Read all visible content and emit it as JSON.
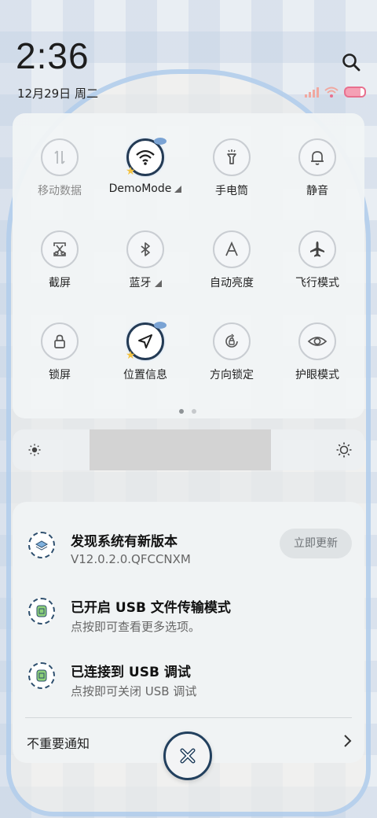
{
  "status_bar": {
    "time": "2:36",
    "date": "12月29日 周二"
  },
  "tiles": [
    {
      "label": "移动数据",
      "icon": "mobile-data-icon",
      "state": "off"
    },
    {
      "label": "DemoMode",
      "icon": "wifi-icon",
      "state": "on",
      "has_menu": true
    },
    {
      "label": "手电筒",
      "icon": "flashlight-icon",
      "state": "off"
    },
    {
      "label": "静音",
      "icon": "bell-icon",
      "state": "off"
    },
    {
      "label": "截屏",
      "icon": "screenshot-icon",
      "state": "off"
    },
    {
      "label": "蓝牙",
      "icon": "bluetooth-icon",
      "state": "off",
      "has_menu": true
    },
    {
      "label": "自动亮度",
      "icon": "auto-brightness-icon",
      "state": "off"
    },
    {
      "label": "飞行模式",
      "icon": "airplane-icon",
      "state": "off"
    },
    {
      "label": "锁屏",
      "icon": "lock-icon",
      "state": "off"
    },
    {
      "label": "位置信息",
      "icon": "location-icon",
      "state": "on"
    },
    {
      "label": "方向锁定",
      "icon": "rotation-lock-icon",
      "state": "off"
    },
    {
      "label": "护眼模式",
      "icon": "eye-icon",
      "state": "off"
    }
  ],
  "page_indicator": {
    "pages": 2,
    "current": 1
  },
  "brightness": {
    "level": 0.66
  },
  "notifications": [
    {
      "title": "发现系统有新版本",
      "body": "V12.0.2.0.QFCCNXM",
      "action": "立即更新"
    },
    {
      "title": "已开启 USB 文件传输模式",
      "body": "点按即可查看更多选项。"
    },
    {
      "title": "已连接到 USB 调试",
      "body": "点按即可关闭 USB 调试"
    }
  ],
  "unimportant_label": "不重要通知",
  "colors": {
    "accent": "#243b55",
    "battery": "#e8708e",
    "signal": "#f0a8a0"
  }
}
